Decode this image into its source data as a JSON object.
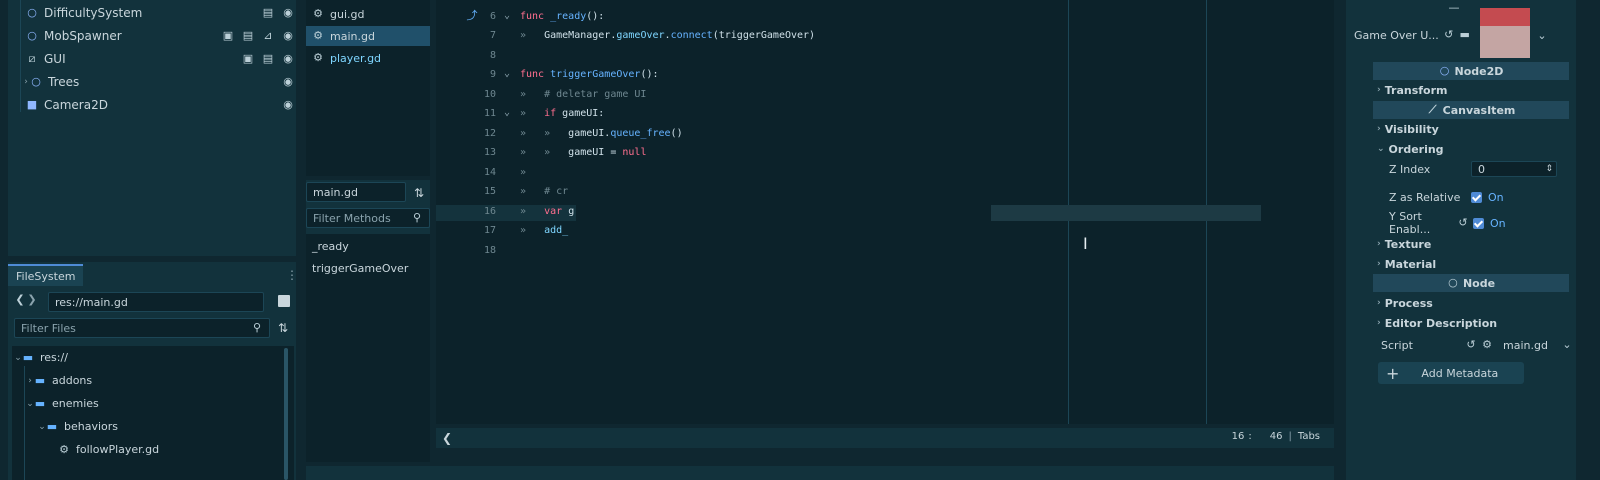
{
  "scene_tree": {
    "items": [
      {
        "name": "DifficultySystem",
        "icons": [
          "script-icon",
          "visibility-icon"
        ]
      },
      {
        "name": "MobSpawner",
        "icons": [
          "scene-icon",
          "script-icon",
          "signal-icon",
          "visibility-icon"
        ]
      },
      {
        "name": "GUI",
        "icons": [
          "scene-icon",
          "script-icon",
          "visibility-icon"
        ]
      },
      {
        "name": "Trees",
        "icons": [
          "visibility-icon"
        ]
      },
      {
        "name": "Camera2D",
        "icons": [
          "visibility-icon"
        ]
      }
    ]
  },
  "filesystem": {
    "tab_label": "FileSystem",
    "path": "res://main.gd",
    "filter_placeholder": "Filter Files",
    "items": [
      {
        "label": "res://",
        "type": "folder"
      },
      {
        "label": "addons",
        "type": "folder"
      },
      {
        "label": "enemies",
        "type": "folder"
      },
      {
        "label": "behaviors",
        "type": "folder"
      },
      {
        "label": "followPlayer.gd",
        "type": "script"
      }
    ]
  },
  "script_list": {
    "files": [
      "gui.gd",
      "main.gd",
      "player.gd"
    ],
    "selected": "main.gd"
  },
  "methods": {
    "current_file": "main.gd",
    "filter_placeholder": "Filter Methods",
    "items": [
      "_ready",
      "triggerGameOver"
    ]
  },
  "code": {
    "line_numbers": [
      "6",
      "7",
      "8",
      "9",
      "10",
      "11",
      "12",
      "13",
      "14",
      "15",
      "16",
      "17",
      "18"
    ],
    "lines": {
      "l6": {
        "kw": "func",
        "name": "_ready",
        "rest": "():"
      },
      "l7": {
        "obj": "GameManager",
        "dot1": ".",
        "prop": "gameOver",
        "dot2": ".",
        "call": "connect",
        "args": "(triggerGameOver)"
      },
      "l9": {
        "kw": "func",
        "name": "triggerGameOver",
        "rest": "():"
      },
      "l10": {
        "comment": "# deletar game UI"
      },
      "l11": {
        "kw": "if",
        "rest": "gameUI:"
      },
      "l12": {
        "obj": "gameUI",
        "dot": ".",
        "call": "queue_free",
        "rest": "()"
      },
      "l13": {
        "obj": "gameUI",
        "op": "=",
        "val": "null"
      },
      "l15": {
        "comment": "# cr"
      },
      "l16": {
        "kw": "var",
        "rest": "g"
      },
      "l17": {
        "text": "add_"
      }
    },
    "status": {
      "line": "16",
      "col": "46",
      "indent": "Tabs"
    }
  },
  "inspector": {
    "header_label": "Game Over U...",
    "sections": {
      "node2d": "Node2D",
      "canvas_item": "CanvasItem",
      "node": "Node"
    },
    "groups": {
      "transform": "Transform",
      "visibility": "Visibility",
      "ordering": "Ordering",
      "texture": "Texture",
      "material": "Material",
      "process": "Process",
      "editor_description": "Editor Description"
    },
    "props": {
      "z_index_label": "Z Index",
      "z_index_value": "0",
      "z_relative_label": "Z as Relative",
      "z_relative_value": "On",
      "y_sort_label": "Y Sort Enabl...",
      "y_sort_value": "On",
      "script_label": "Script",
      "script_value": "main.gd"
    },
    "add_metadata_label": "Add Metadata"
  },
  "colors": {
    "accent": "#4f8bd6",
    "background": "#0f2730",
    "panel": "#12323c",
    "keyword": "#ff6f8f",
    "function": "#66b3ff"
  }
}
